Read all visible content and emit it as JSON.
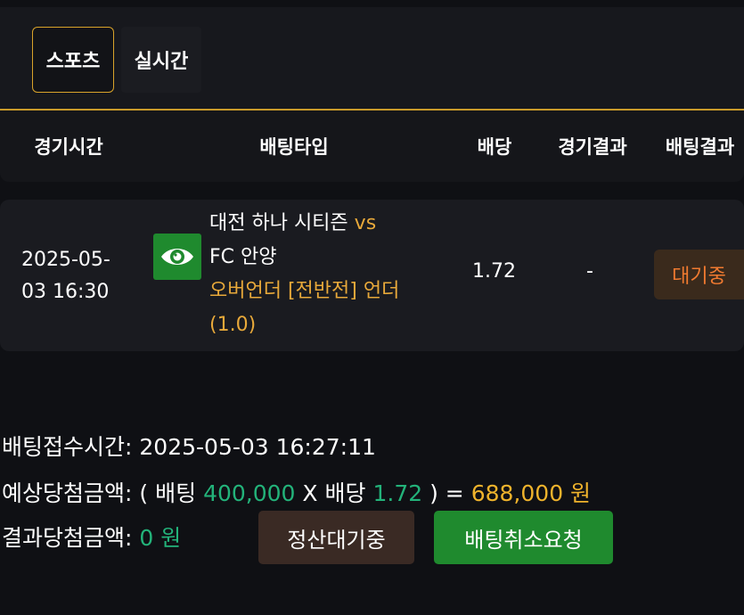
{
  "tabs": {
    "sports": "스포츠",
    "live": "실시간"
  },
  "columns": {
    "game_time": "경기시간",
    "bet_type": "배팅타입",
    "odds": "배당",
    "game_result": "경기결과",
    "bet_result": "배팅결과"
  },
  "bet": {
    "time_line1": "2025-05-",
    "time_line2": "03 16:30",
    "eye_icon": "eye-icon",
    "home_team": "대전 하나 시티즌",
    "vs": "vs",
    "away_team": "FC 안양",
    "market": "오버언더 [전반전] 언더",
    "line": "(1.0)",
    "odds": "1.72",
    "game_result": "-",
    "status": "대기중"
  },
  "summary": {
    "received_label": "배팅접수시간:",
    "received_time": "2025-05-03 16:27:11",
    "expected_label": "예상당첨금액:",
    "open_paren": "(",
    "bet_word": "배팅",
    "bet_amount": "400,000",
    "times": "X",
    "odds_word": "배당",
    "odds_value": "1.72",
    "close_eq": ") =",
    "expected_amount": "688,000 원",
    "result_label": "결과당첨금액:",
    "result_amount": "0 원"
  },
  "buttons": {
    "settle_wait": "정산대기중",
    "cancel_request": "배팅취소요청"
  },
  "colors": {
    "accent_gold": "#d9a32a",
    "green": "#1f8a2e",
    "teal": "#23b37a",
    "orange": "#efb32c",
    "status_orange": "#f07a30"
  }
}
